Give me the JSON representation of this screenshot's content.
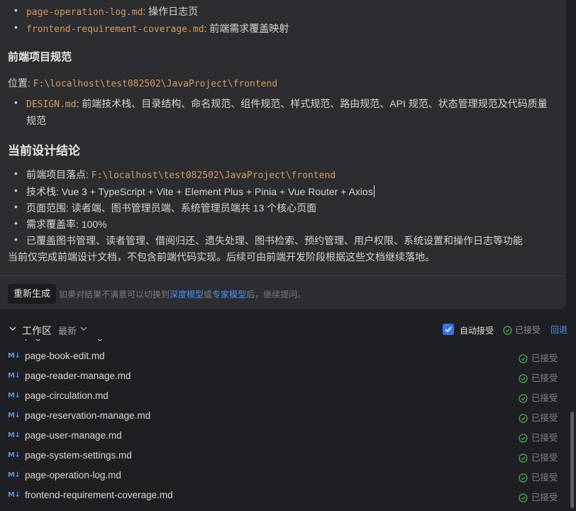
{
  "chat": {
    "top_bullets": [
      {
        "code": "page-operation-log.md",
        "sep": ": ",
        "text": "操作日志页"
      },
      {
        "code": "frontend-requirement-coverage.md",
        "sep": ": ",
        "text": "前端需求覆盖映射"
      }
    ],
    "section_frontend_title": "前端项目规范",
    "location_label": "位置: ",
    "location_path": "F:\\localhost\\test082502\\JavaProject\\frontend",
    "design_bullet": {
      "code": "DESIGN.md",
      "sep": ": ",
      "text_line1": "前端技术栈、目录结构、命名规范、组件规范、样式规范、路由规范、API 规范、状态管理规范及代码质量",
      "text_line2": "规范"
    },
    "conclusion_title": "当前设计结论",
    "conclusion_bullets": {
      "b1_label": "前端项目落点: ",
      "b1_code": "F:\\localhost\\test082502\\JavaProject\\frontend",
      "b2": "技术栈: Vue 3 + TypeScript + Vite + Element Plus + Pinia + Vue Router + Axios",
      "b3": "页面范围: 读者端、图书管理员端、系统管理员端共 13 个核心页面",
      "b4": "需求覆盖率: 100%",
      "b5": "已覆盖图书管理、读者管理、借阅归还、遗失处理、图书检索、预约管理、用户权限、系统设置和操作日志等功能"
    },
    "closing_text": "当前仅完成前端设计文档，不包含前端代码实现。后续可由前端开发阶段根据这些文档继续落地。",
    "regenerate_label": "重新生成",
    "hint_prefix": "如果对结果不满意可以切换到",
    "hint_link1": "深度模型",
    "hint_mid": "或",
    "hint_link2": "专家模型",
    "hint_suffix": "后，继续提问。"
  },
  "workspace": {
    "title": "工作区",
    "recent": "最新",
    "auto_accept_label": "自动接受",
    "auto_accept_checked": true,
    "accepted_all": "已接受",
    "rollback": "回退",
    "files": [
      {
        "name": "page-book-edit.md",
        "status": "已接受"
      },
      {
        "name": "page-reader-manage.md",
        "status": "已接受"
      },
      {
        "name": "page-circulation.md",
        "status": "已接受"
      },
      {
        "name": "page-reservation-manage.md",
        "status": "已接受"
      },
      {
        "name": "page-user-manage.md",
        "status": "已接受"
      },
      {
        "name": "page-system-settings.md",
        "status": "已接受"
      },
      {
        "name": "page-operation-log.md",
        "status": "已接受"
      },
      {
        "name": "frontend-requirement-coverage.md",
        "status": "已接受"
      }
    ],
    "md_icon_text": "M↓"
  },
  "colors": {
    "code": "#d79b5e",
    "accent": "#3574f0",
    "link": "#4d8ef7",
    "accepted_check": "#4caf50"
  }
}
